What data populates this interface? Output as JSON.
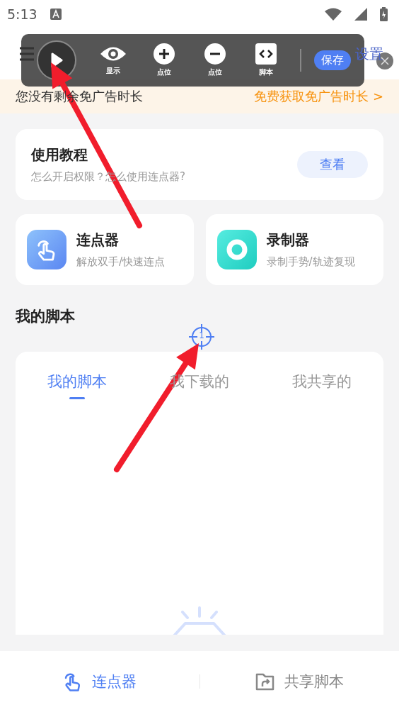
{
  "status_bar": {
    "time": "5:13"
  },
  "header": {
    "settings": "设置"
  },
  "floating_toolbar": {
    "tools": [
      {
        "kind": "eye",
        "label": "显示"
      },
      {
        "kind": "plus",
        "label": "点位"
      },
      {
        "kind": "minus",
        "label": "点位"
      },
      {
        "kind": "code",
        "label": "脚本"
      }
    ],
    "save": "保存"
  },
  "banner": {
    "message": "您没有剩余免广告时长",
    "link": "免费获取免广告时长 >"
  },
  "tutorial": {
    "title": "使用教程",
    "subtitle": "怎么开启权限？怎么使用连点器?",
    "button": "查看"
  },
  "features": [
    {
      "kind": "clicker",
      "title": "连点器",
      "subtitle": "解放双手/快速连点"
    },
    {
      "kind": "recorder",
      "title": "录制器",
      "subtitle": "录制手势/轨迹复现"
    }
  ],
  "scripts": {
    "heading": "我的脚本",
    "tabs": [
      {
        "label": "我的脚本",
        "selected": true
      },
      {
        "label": "我下载的",
        "selected": false
      },
      {
        "label": "我共享的",
        "selected": false
      }
    ]
  },
  "target_marker": {
    "label": "1"
  },
  "bottom_nav": [
    {
      "kind": "clicker",
      "label": "连点器",
      "selected": true
    },
    {
      "kind": "share",
      "label": "共享脚本",
      "selected": false
    }
  ]
}
